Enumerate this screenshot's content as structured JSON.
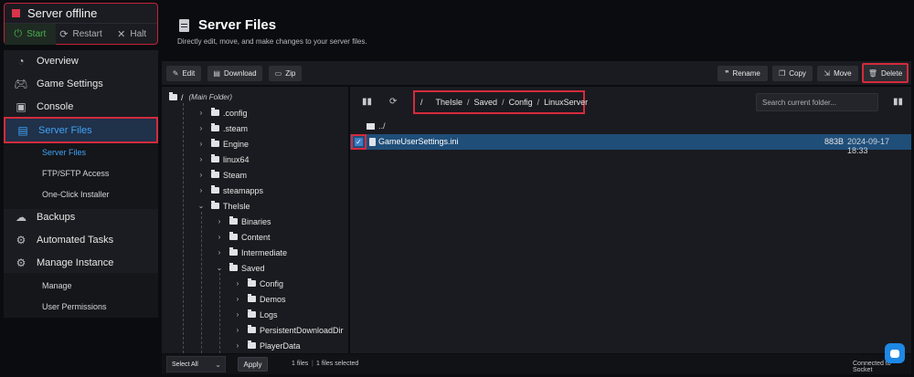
{
  "server": {
    "status": "Server offline",
    "actions": [
      {
        "label": "Start",
        "icon": "power-icon"
      },
      {
        "label": "Restart",
        "icon": "refresh-icon"
      },
      {
        "label": "Halt",
        "icon": "close-icon"
      }
    ]
  },
  "sidebar": {
    "items": [
      {
        "label": "Overview",
        "icon": "gauge-icon"
      },
      {
        "label": "Game Settings",
        "icon": "gamepad-icon"
      },
      {
        "label": "Console",
        "icon": "terminal-icon"
      },
      {
        "label": "Server Files",
        "icon": "file-icon",
        "active": true
      },
      {
        "label": "Backups",
        "icon": "cloud-backup-icon"
      },
      {
        "label": "Automated Tasks",
        "icon": "cog-timer-icon"
      },
      {
        "label": "Manage Instance",
        "icon": "gear-icon"
      }
    ],
    "server_files_sub": [
      "Server Files",
      "FTP/SFTP Access",
      "One-Click Installer"
    ],
    "manage_sub": [
      "Manage",
      "User Permissions"
    ]
  },
  "page": {
    "title": "Server Files",
    "subtitle": "Directly edit, move, and make changes to your server files."
  },
  "toolbar": {
    "edit": "Edit",
    "download": "Download",
    "zip": "Zip",
    "rename": "Rename",
    "copy": "Copy",
    "move": "Move",
    "delete": "Delete"
  },
  "tree": {
    "root_slash": "/",
    "root_label": "(Main Folder)",
    "level1": [
      ".config",
      ".steam",
      "Engine",
      "linux64",
      "Steam",
      "steamapps",
      "TheIsle"
    ],
    "level2": [
      "Binaries",
      "Content",
      "Intermediate",
      "Saved"
    ],
    "level3": [
      "Config",
      "Demos",
      "Logs",
      "PersistentDownloadDir",
      "PlayerData"
    ]
  },
  "files": {
    "breadcrumb": [
      "/",
      "TheIsle",
      "/",
      "Saved",
      "/",
      "Config",
      "/",
      "LinuxServer"
    ],
    "search_placeholder": "Search current folder...",
    "parent_label": "../",
    "rows": [
      {
        "name": "GameUserSettings.ini",
        "size": "883B",
        "modified": "2024-09-17 18:33",
        "selected": true
      }
    ]
  },
  "footer": {
    "select_value": "Select All",
    "apply": "Apply",
    "file_count": "1 files",
    "selected_count": "1 files selected",
    "connection": "Connected to Socket"
  },
  "colors": {
    "accent": "#3fa3f5",
    "highlight": "#d42b3c",
    "selected_row": "#1f4e79",
    "start_green": "#4caf50"
  }
}
